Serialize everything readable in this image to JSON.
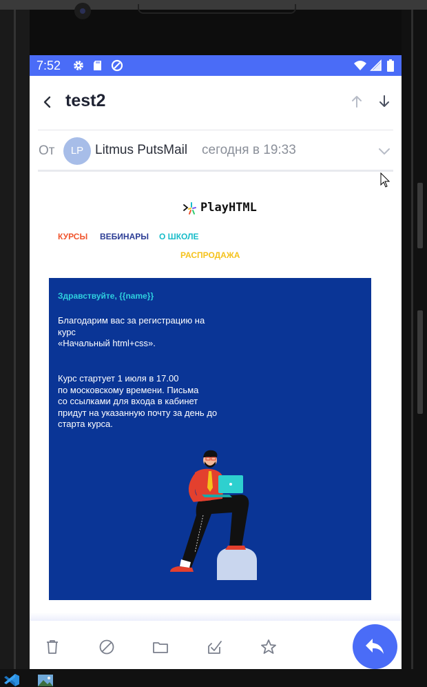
{
  "statusbar": {
    "time": "7:52"
  },
  "message": {
    "subject": "test2",
    "from_label": "От",
    "avatar_initials": "LP",
    "sender": "Litmus PutsMail",
    "date": "сегодня в 19:33"
  },
  "email": {
    "brand": "PlayHTML",
    "menu": [
      {
        "label": "КУРСЫ",
        "color": "#f0542d"
      },
      {
        "label": "ВЕБИНАРЫ",
        "color": "#2c3d95"
      },
      {
        "label": "О ШКОЛЕ",
        "color": "#18bcc9"
      },
      {
        "label": "РАСПРОДАЖА",
        "color": "#f5c21b"
      }
    ],
    "greeting": "Здравствуйте, {{name}}",
    "paragraph1_lines": [
      "Благодарим вас за регистрацию на",
      "курс",
      "«Начальный html+css»."
    ],
    "paragraph2_lines": [
      "Курс стартует 1 июля в 17.00",
      "по московскому времени. Письма",
      "со  ссылками для входа в кабинет",
      "придут на указанную почту за день до",
      "старта курса."
    ]
  },
  "toolbar_icons": [
    "trash-icon",
    "block-icon",
    "folder-icon",
    "mark-read-icon",
    "star-icon"
  ],
  "fab_icon": "reply-icon",
  "colors": {
    "accent": "#4a6cf7",
    "hero_bg": "#0a3596",
    "greeting": "#2ed0df",
    "avatar": "#a7bde8"
  }
}
